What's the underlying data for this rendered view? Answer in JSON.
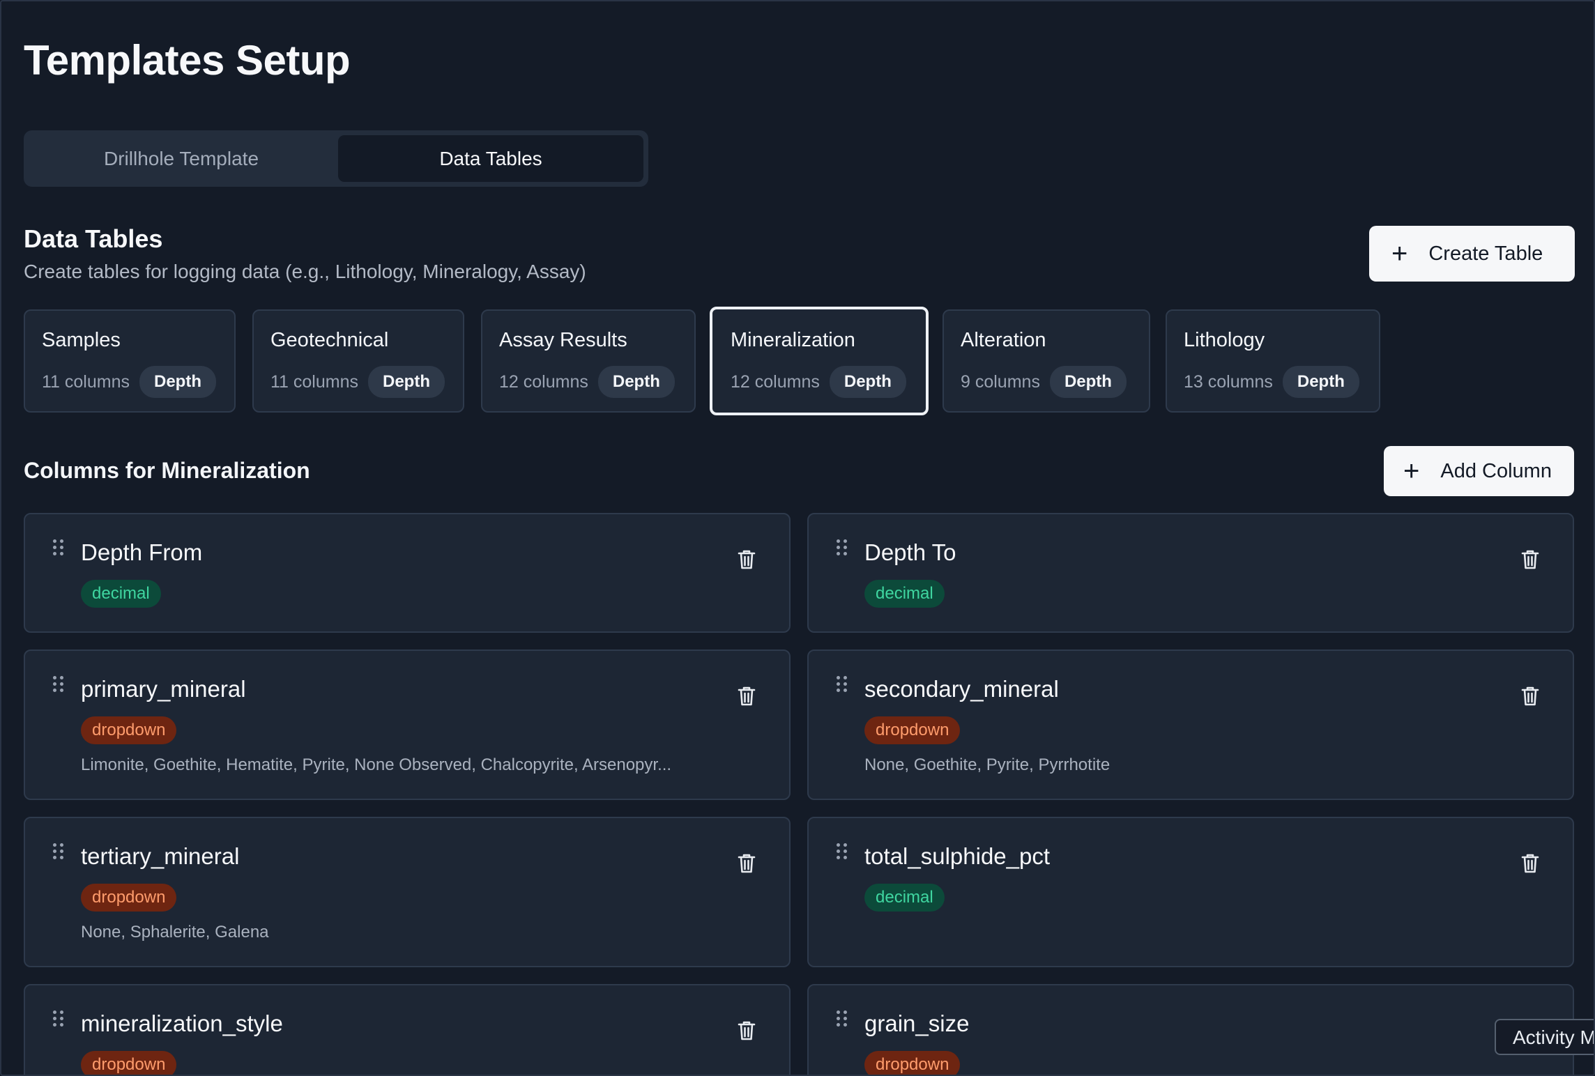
{
  "page": {
    "title": "Templates Setup"
  },
  "tabs": [
    {
      "label": "Drillhole Template",
      "active": false
    },
    {
      "label": "Data Tables",
      "active": true
    }
  ],
  "data_tables": {
    "title": "Data Tables",
    "subtitle": "Create tables for logging data (e.g., Lithology, Mineralogy, Assay)",
    "create_label": "Create Table",
    "tables": [
      {
        "name": "Samples",
        "count": "11 columns",
        "badge": "Depth",
        "selected": false
      },
      {
        "name": "Geotechnical",
        "count": "11 columns",
        "badge": "Depth",
        "selected": false
      },
      {
        "name": "Assay Results",
        "count": "12 columns",
        "badge": "Depth",
        "selected": false
      },
      {
        "name": "Mineralization",
        "count": "12 columns",
        "badge": "Depth",
        "selected": true
      },
      {
        "name": "Alteration",
        "count": "9 columns",
        "badge": "Depth",
        "selected": false
      },
      {
        "name": "Lithology",
        "count": "13 columns",
        "badge": "Depth",
        "selected": false
      }
    ]
  },
  "columns_section": {
    "title": "Columns for Mineralization",
    "add_label": "Add Column",
    "columns": [
      {
        "name": "Depth From",
        "type": "decimal",
        "options": ""
      },
      {
        "name": "Depth To",
        "type": "decimal",
        "options": ""
      },
      {
        "name": "primary_mineral",
        "type": "dropdown",
        "options": "Limonite, Goethite, Hematite, Pyrite, None Observed, Chalcopyrite, Arsenopyr..."
      },
      {
        "name": "secondary_mineral",
        "type": "dropdown",
        "options": "None, Goethite, Pyrite, Pyrrhotite"
      },
      {
        "name": "tertiary_mineral",
        "type": "dropdown",
        "options": "None, Sphalerite, Galena"
      },
      {
        "name": "total_sulphide_pct",
        "type": "decimal",
        "options": ""
      },
      {
        "name": "mineralization_style",
        "type": "dropdown",
        "options": ""
      },
      {
        "name": "grain_size",
        "type": "dropdown",
        "options": ""
      }
    ]
  },
  "tooltip": {
    "text": "Activity M"
  },
  "icons": {
    "add": "plus-icon",
    "delete": "trash-icon",
    "drag": "drag-handle-icon"
  },
  "colors": {
    "background": "#141b27",
    "card": "#1d2634",
    "decimal_badge": "#0c4a3a",
    "decimal_text": "#3fd6a0",
    "dropdown_badge": "#6e2511",
    "dropdown_text": "#ff9c6c"
  }
}
